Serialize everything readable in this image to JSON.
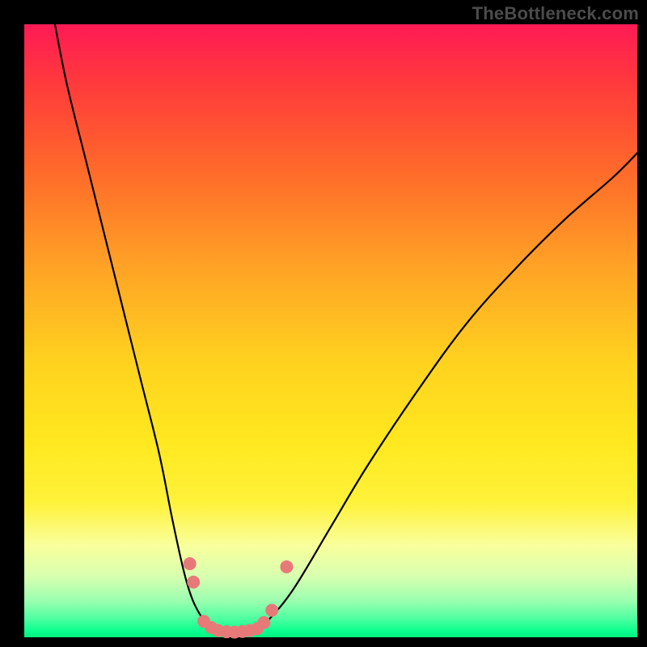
{
  "watermark": "TheBottleneck.com",
  "colors": {
    "frame": "#000000",
    "gradient_top": "#ff1a55",
    "gradient_bottom": "#00f07f",
    "curve_stroke": "#000000",
    "marker_fill": "#e77a78"
  },
  "chart_data": {
    "type": "line",
    "title": "",
    "xlabel": "",
    "ylabel": "",
    "xlim": [
      0,
      100
    ],
    "ylim": [
      0,
      100
    ],
    "notes": "No axis ticks or labels are visible in the image; values below are geometric estimates from the shape of the curves, normalized to a 0–100 scale on both axes.",
    "series": [
      {
        "name": "left-branch",
        "x": [
          5,
          7,
          10,
          13,
          16,
          19,
          22,
          24,
          25.5,
          26.5,
          27.5,
          28.5,
          29.5,
          30.5
        ],
        "y": [
          100,
          90,
          78,
          66,
          54,
          42,
          30,
          20,
          13,
          9,
          6,
          4,
          2.5,
          1.5
        ]
      },
      {
        "name": "valley-floor",
        "x": [
          30.5,
          32,
          34,
          36,
          38
        ],
        "y": [
          1.5,
          1,
          0.8,
          0.9,
          1.3
        ]
      },
      {
        "name": "right-branch",
        "x": [
          38,
          40,
          44,
          50,
          56,
          64,
          72,
          80,
          88,
          96,
          100
        ],
        "y": [
          1.3,
          3,
          8,
          18,
          28,
          40,
          51,
          60,
          68,
          75,
          79
        ]
      }
    ],
    "markers": [
      {
        "x": 27.0,
        "y": 12.0
      },
      {
        "x": 27.6,
        "y": 9.0
      },
      {
        "x": 29.3,
        "y": 2.6
      },
      {
        "x": 30.5,
        "y": 1.6
      },
      {
        "x": 31.6,
        "y": 1.1
      },
      {
        "x": 33.0,
        "y": 0.9
      },
      {
        "x": 34.3,
        "y": 0.85
      },
      {
        "x": 35.6,
        "y": 0.95
      },
      {
        "x": 36.8,
        "y": 1.1
      },
      {
        "x": 38.0,
        "y": 1.4
      },
      {
        "x": 39.1,
        "y": 2.4
      },
      {
        "x": 40.4,
        "y": 4.4
      },
      {
        "x": 42.8,
        "y": 11.5
      }
    ]
  }
}
